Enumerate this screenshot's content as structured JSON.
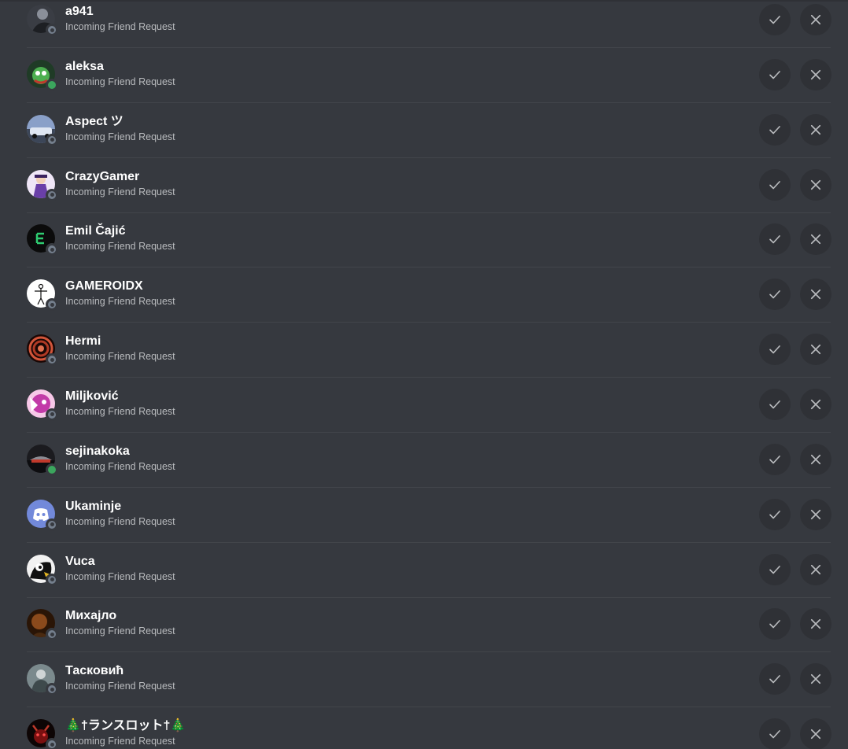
{
  "friend_requests": [
    {
      "name": "a941",
      "subtext": "Incoming Friend Request",
      "status": "offline",
      "avatar_color": "#3a3d44",
      "avatar_icon": "dark-figure-avatar"
    },
    {
      "name": "aleksa",
      "subtext": "Incoming Friend Request",
      "status": "online",
      "avatar_color": "#2f6b3a",
      "avatar_icon": "green-creature-avatar"
    },
    {
      "name": "Aspect ツ",
      "subtext": "Incoming Friend Request",
      "status": "offline",
      "avatar_color": "#4a5a7a",
      "avatar_icon": "car-avatar"
    },
    {
      "name": "CrazyGamer",
      "subtext": "Incoming Friend Request",
      "status": "offline",
      "avatar_color": "#6a4a8a",
      "avatar_icon": "purple-character-avatar"
    },
    {
      "name": "Emil Čajić",
      "subtext": "Incoming Friend Request",
      "status": "offline",
      "avatar_color": "#111111",
      "avatar_icon": "green-logo-avatar"
    },
    {
      "name": "GAMEROIDX",
      "subtext": "Incoming Friend Request",
      "status": "offline",
      "avatar_color": "#ffffff",
      "avatar_icon": "stick-figure-avatar"
    },
    {
      "name": "Hermi",
      "subtext": "Incoming Friend Request",
      "status": "offline",
      "avatar_color": "#5a1a14",
      "avatar_icon": "spiral-mask-avatar"
    },
    {
      "name": "Miljković",
      "subtext": "Incoming Friend Request",
      "status": "offline",
      "avatar_color": "#c23aa8",
      "avatar_icon": "pink-anime-avatar"
    },
    {
      "name": "sejinakoka",
      "subtext": "Incoming Friend Request",
      "status": "online",
      "avatar_color": "#2a2a2e",
      "avatar_icon": "car-night-avatar"
    },
    {
      "name": "Ukaminje",
      "subtext": "Incoming Friend Request",
      "status": "offline",
      "avatar_color": "#7289da",
      "avatar_icon": "discord-logo-avatar"
    },
    {
      "name": "Vuca",
      "subtext": "Incoming Friend Request",
      "status": "offline",
      "avatar_color": "#e8e8e8",
      "avatar_icon": "penguin-avatar"
    },
    {
      "name": "Михајло",
      "subtext": "Incoming Friend Request",
      "status": "offline",
      "avatar_color": "#6b3a1a",
      "avatar_icon": "portrait-avatar"
    },
    {
      "name": "Тасковић",
      "subtext": "Incoming Friend Request",
      "status": "offline",
      "avatar_color": "#5a6a6e",
      "avatar_icon": "soldier-avatar"
    },
    {
      "name": "🎄†ランスロット†🎄",
      "subtext": "Incoming Friend Request",
      "status": "offline",
      "avatar_color": "#1a0a0a",
      "avatar_icon": "red-demon-avatar"
    }
  ],
  "colors": {
    "background": "#36393f",
    "button_bg": "#2f3136",
    "icon": "#b9bbbe",
    "online": "#3ba55d",
    "offline": "#747f8d"
  },
  "icons": {
    "accept": "check-icon",
    "decline": "close-icon"
  }
}
